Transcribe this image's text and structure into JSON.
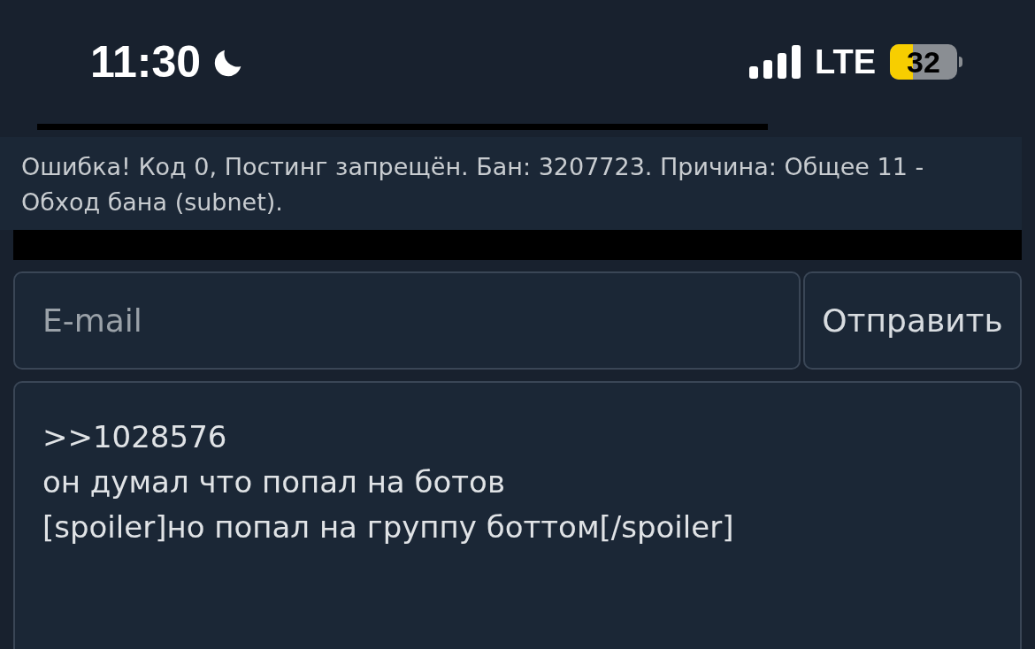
{
  "status_bar": {
    "time": "11:30",
    "network": "LTE",
    "battery": "32"
  },
  "error_toast": {
    "text": "Ошибка! Код 0, Постинг запрещён. Бан: 3207723. Причина: Общее 11 - Обход бана (subnet)."
  },
  "reply_form": {
    "email": {
      "placeholder": "E-mail"
    },
    "submit": "Отправить",
    "message": ">>1028576\nон думал что попал на ботов\n[spoiler]но попал на группу боттом[/spoiler]"
  }
}
